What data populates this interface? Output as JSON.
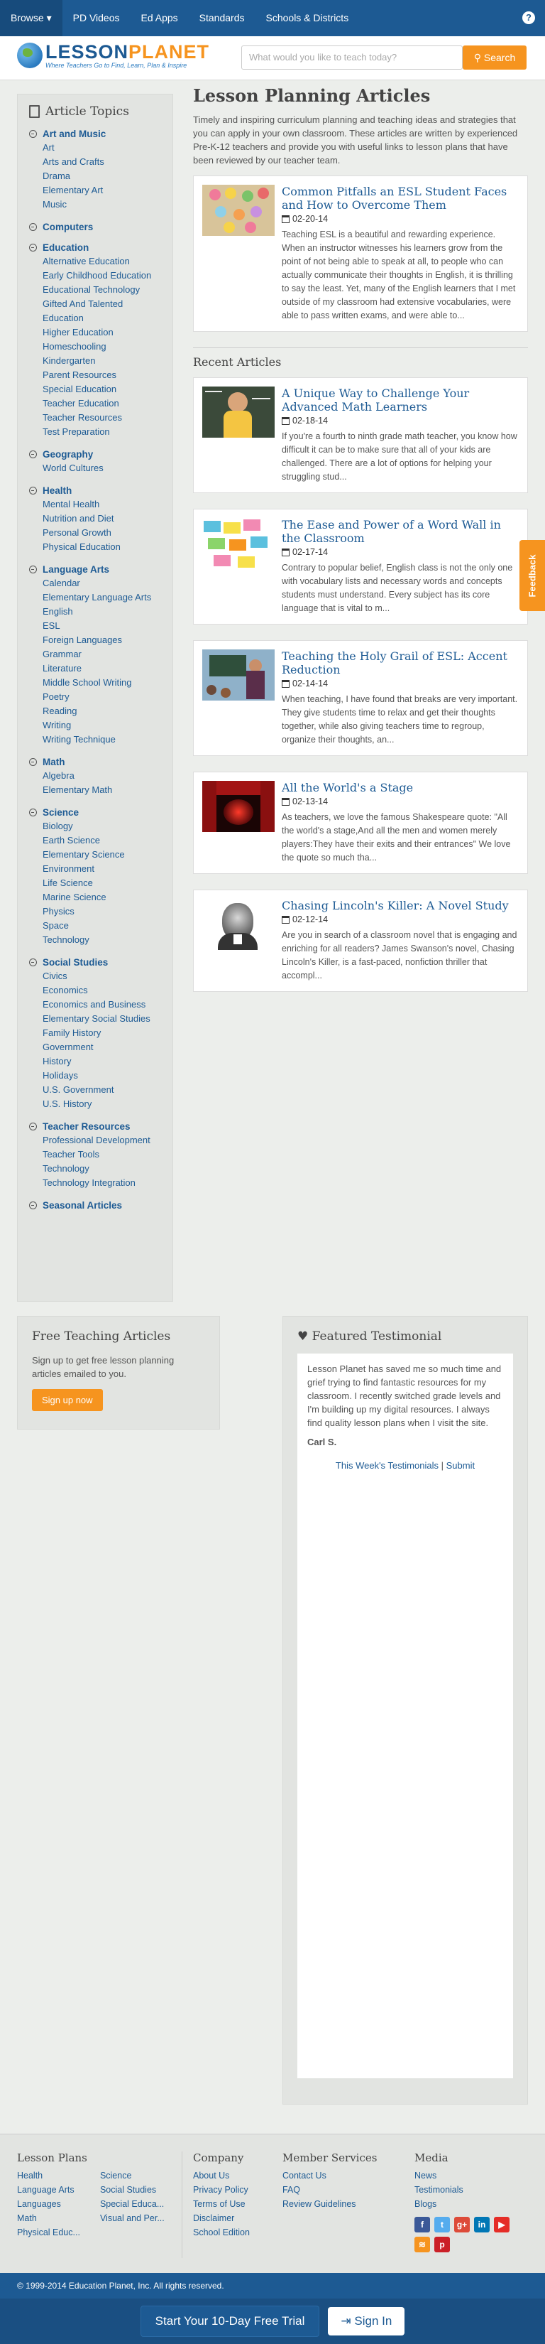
{
  "nav": {
    "items": [
      "Browse",
      "PD Videos",
      "Ed Apps",
      "Standards",
      "Schools & Districts"
    ],
    "help": "?"
  },
  "logo": {
    "name_a": "LESSON",
    "name_b": "PLANET",
    "tagline": "Where Teachers Go to Find, Learn, Plan & Inspire"
  },
  "search": {
    "placeholder": "What would you like to teach today?",
    "button": "Search"
  },
  "sidebar": {
    "title": "Article Topics",
    "categories": [
      {
        "name": "Art and Music",
        "items": [
          "Art",
          "Arts and Crafts",
          "Drama",
          "Elementary Art",
          "Music"
        ]
      },
      {
        "name": "Computers",
        "items": []
      },
      {
        "name": "Education",
        "items": [
          "Alternative Education",
          "Early Childhood Education",
          "Educational Technology",
          "Gifted And Talented Education",
          "Higher Education",
          "Homeschooling",
          "Kindergarten",
          "Parent Resources",
          "Special Education",
          "Teacher Education",
          "Teacher Resources",
          "Test Preparation"
        ]
      },
      {
        "name": "Geography",
        "items": [
          "World Cultures"
        ]
      },
      {
        "name": "Health",
        "items": [
          "Mental Health",
          "Nutrition and Diet",
          "Personal Growth",
          "Physical Education"
        ]
      },
      {
        "name": "Language Arts",
        "items": [
          "Calendar",
          "Elementary Language Arts",
          "English",
          "ESL",
          "Foreign Languages",
          "Grammar",
          "Literature",
          "Middle School Writing",
          "Poetry",
          "Reading",
          "Writing",
          "Writing Technique"
        ]
      },
      {
        "name": "Math",
        "items": [
          "Algebra",
          "Elementary Math"
        ]
      },
      {
        "name": "Science",
        "items": [
          "Biology",
          "Earth Science",
          "Elementary Science",
          "Environment",
          "Life Science",
          "Marine Science",
          "Physics",
          "Space",
          "Technology"
        ]
      },
      {
        "name": "Social Studies",
        "items": [
          "Civics",
          "Economics",
          "Economics and Business",
          "Elementary Social Studies",
          "Family History",
          "Government",
          "History",
          "Holidays",
          "U.S. Government",
          "U.S. History"
        ]
      },
      {
        "name": "Teacher Resources",
        "items": [
          "Professional Development",
          "Teacher Tools",
          "Technology",
          "Technology Integration"
        ]
      },
      {
        "name": "Seasonal Articles",
        "items": []
      }
    ]
  },
  "main": {
    "title": "Lesson Planning Articles",
    "intro": "Timely and inspiring curriculum planning and teaching ideas and strategies that you can apply in your own classroom. These articles are written by experienced Pre-K-12 teachers and provide you with useful links to lesson plans that have been reviewed by our teacher team.",
    "featured": {
      "title": "Common Pitfalls an ESL Student Faces and How to Overcome Them",
      "date": "02-20-14",
      "text": "Teaching ESL is a beautiful and rewarding experience. When an instructor witnesses his learners grow from the point of not being able to speak at all, to people who can actually communicate their thoughts in English, it is thrilling to say the least. Yet, many of the English learners that I met outside of my classroom had extensive vocabularies, were able to pass written exams, and were able to..."
    },
    "recent_title": "Recent Articles",
    "articles": [
      {
        "title": "A Unique Way to Challenge Your Advanced Math Learners",
        "date": "02-18-14",
        "text": "If you're a fourth to ninth grade math teacher, you know how difficult it can be to make sure that all of your kids are challenged. There are a lot of options for helping your struggling stud..."
      },
      {
        "title": "The Ease and Power of a Word Wall in the Classroom",
        "date": "02-17-14",
        "text": "Contrary to popular belief, English class is not the only one with vocabulary lists and necessary words and concepts students must understand. Every subject has its core language that is vital to m..."
      },
      {
        "title": "Teaching the Holy Grail of ESL: Accent Reduction",
        "date": "02-14-14",
        "text": "When teaching, I have found that breaks are very important. They give students time to relax and get their thoughts together, while also giving teachers time to regroup, organize their thoughts, an..."
      },
      {
        "title": "All the World's a Stage",
        "date": "02-13-14",
        "text": "As teachers, we love the famous Shakespeare quote: \"All the world's a stage,And all the men and women merely players:They have their exits and their entrances\" We love the quote so much tha..."
      },
      {
        "title": "Chasing Lincoln's Killer: A Novel Study",
        "date": "02-12-14",
        "text": "Are you in search of a classroom novel that is engaging and enriching for all readers? James Swanson's novel, Chasing Lincoln's Killer, is a fast-paced, nonfiction thriller that accompl..."
      }
    ]
  },
  "free_articles": {
    "title": "Free Teaching Articles",
    "text": "Sign up to get free lesson planning articles emailed to you.",
    "button": "Sign up now"
  },
  "testimonial": {
    "title": "Featured Testimonial",
    "text": "Lesson Planet has saved me so much time and grief trying to find fantastic resources for my classroom. I recently switched grade levels and I'm building up my digital resources. I always find quality lesson plans when I visit the site.",
    "author": "Carl S.",
    "link_a": "This Week's Testimonials",
    "sep": "|",
    "link_b": "Submit"
  },
  "footer": {
    "lesson_plans": {
      "title": "Lesson Plans",
      "col1": [
        "Health",
        "Language Arts",
        "Languages",
        "Math",
        "Physical Educ..."
      ],
      "col2": [
        "Science",
        "Social Studies",
        "Special Educa...",
        "Visual and Per..."
      ]
    },
    "company": {
      "title": "Company",
      "links": [
        "About Us",
        "Privacy Policy",
        "Terms of Use",
        "Disclaimer",
        "School Edition"
      ]
    },
    "member": {
      "title": "Member Services",
      "links": [
        "Contact Us",
        "FAQ",
        "Review Guidelines"
      ]
    },
    "media": {
      "title": "Media",
      "links": [
        "News",
        "Testimonials",
        "Blogs"
      ]
    },
    "copyright": "© 1999-2014 Education Planet, Inc. All rights reserved."
  },
  "cta": {
    "trial": "Start Your 10-Day Free Trial",
    "signin": "Sign In"
  },
  "feedback": "Feedback",
  "colors": {
    "brand": "#1d5a93",
    "accent": "#f6941f"
  }
}
